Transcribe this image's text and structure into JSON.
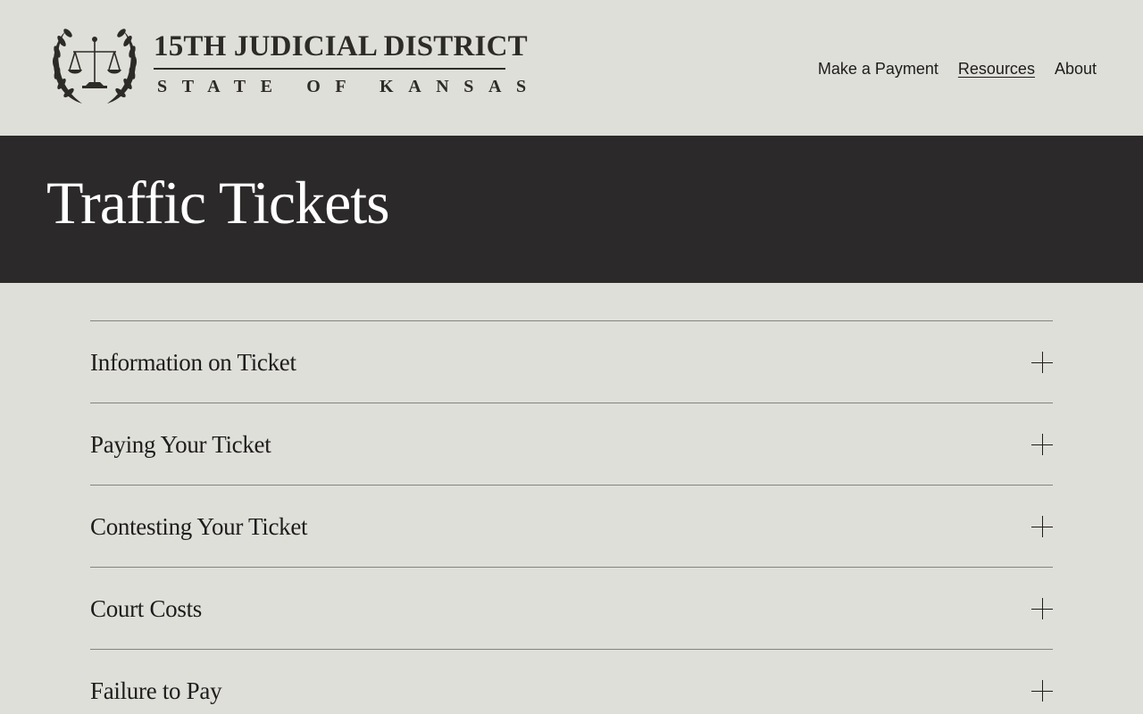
{
  "header": {
    "logo": {
      "title": "15TH JUDICIAL DISTRICT",
      "subtitle": "STATE OF KANSAS",
      "emblem_icon": "scales-of-justice-laurel-icon"
    },
    "nav": [
      {
        "label": "Make a Payment",
        "active": false
      },
      {
        "label": "Resources",
        "active": true
      },
      {
        "label": "About",
        "active": false
      }
    ]
  },
  "hero": {
    "title": "Traffic Tickets"
  },
  "accordion": {
    "expand_icon": "plus-icon",
    "items": [
      {
        "label": "Information on Ticket"
      },
      {
        "label": "Paying Your Ticket"
      },
      {
        "label": "Contesting Your Ticket"
      },
      {
        "label": "Court Costs"
      },
      {
        "label": "Failure to Pay"
      }
    ]
  },
  "colors": {
    "page_background": "#dfdfd9",
    "hero_background": "#2b2929",
    "text": "#1e1c1c",
    "divider": "#858580"
  }
}
